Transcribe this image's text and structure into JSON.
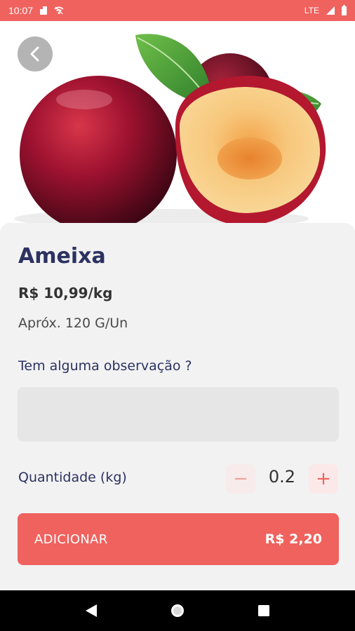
{
  "status_bar": {
    "time": "10:07",
    "network": "LTE"
  },
  "product": {
    "name": "Ameixa",
    "price": "R$ 10,99/kg",
    "approx": "Apróx. 120 G/Un"
  },
  "observation": {
    "label": "Tem alguma observação ?",
    "value": "",
    "placeholder": ""
  },
  "quantity": {
    "label": "Quantidade (kg)",
    "value": "0.2",
    "minus": "−",
    "plus": "+"
  },
  "add_button": {
    "label": "ADICIONAR",
    "total": "R$ 2,20"
  },
  "colors": {
    "accent": "#f0625e",
    "title": "#2c3260",
    "sheet": "#f2f2f3"
  },
  "icons": [
    "sd-card-icon",
    "wifi-off-icon",
    "signal-icon",
    "battery-icon",
    "back-arrow-icon",
    "nav-back-icon",
    "nav-home-icon",
    "nav-recents-icon"
  ]
}
